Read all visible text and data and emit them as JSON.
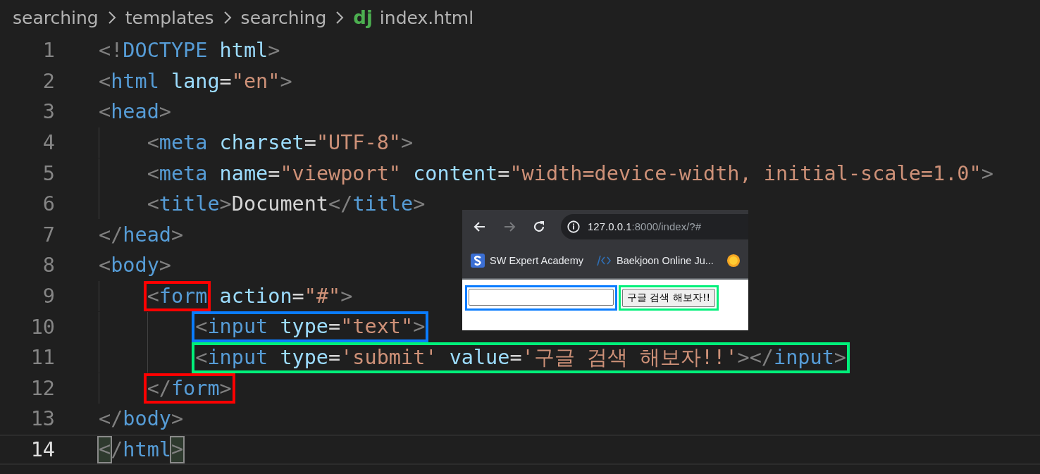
{
  "breadcrumb": [
    {
      "label": "searching"
    },
    {
      "label": "templates"
    },
    {
      "label": "searching"
    },
    {
      "label": "index.html",
      "logo_text": "dj"
    }
  ],
  "lines": [
    {
      "number": "1",
      "current": false,
      "segments": [
        {
          "kind": "code",
          "tokens": [
            {
              "kind": "punct",
              "text": "<!"
            },
            {
              "kind": "tag",
              "text": "DOCTYPE"
            },
            {
              "kind": "attr",
              "text": " html"
            },
            {
              "kind": "punct",
              "text": ">"
            }
          ]
        }
      ]
    },
    {
      "number": "2",
      "current": false,
      "segments": [
        {
          "kind": "code",
          "tokens": [
            {
              "kind": "punct",
              "text": "<"
            },
            {
              "kind": "tag",
              "text": "html"
            },
            {
              "kind": "attr",
              "text": " lang"
            },
            {
              "kind": "text",
              "text": "="
            },
            {
              "kind": "str",
              "text": "\"en\""
            },
            {
              "kind": "punct",
              "text": ">"
            }
          ]
        }
      ]
    },
    {
      "number": "3",
      "current": false,
      "segments": [
        {
          "kind": "code",
          "tokens": [
            {
              "kind": "punct",
              "text": "<"
            },
            {
              "kind": "tag",
              "text": "head"
            },
            {
              "kind": "punct",
              "text": ">"
            }
          ]
        }
      ],
      "children": [
        {
          "number": "4",
          "current": false,
          "segments": [
            {
              "kind": "code",
              "tokens": [
                {
                  "kind": "punct",
                  "text": "<"
                },
                {
                  "kind": "tag",
                  "text": "meta"
                },
                {
                  "kind": "attr",
                  "text": " charset"
                },
                {
                  "kind": "text",
                  "text": "="
                },
                {
                  "kind": "str",
                  "text": "\"UTF-8\""
                },
                {
                  "kind": "punct",
                  "text": ">"
                }
              ]
            }
          ]
        },
        {
          "number": "5",
          "current": false,
          "segments": [
            {
              "kind": "code",
              "tokens": [
                {
                  "kind": "punct",
                  "text": "<"
                },
                {
                  "kind": "tag",
                  "text": "meta"
                },
                {
                  "kind": "attr",
                  "text": " name"
                },
                {
                  "kind": "text",
                  "text": "="
                },
                {
                  "kind": "str",
                  "text": "\"viewport\""
                },
                {
                  "kind": "attr",
                  "text": " content"
                },
                {
                  "kind": "text",
                  "text": "="
                },
                {
                  "kind": "str",
                  "text": "\"width=device-width, initial-scale=1.0\""
                },
                {
                  "kind": "punct",
                  "text": ">"
                }
              ]
            }
          ]
        },
        {
          "number": "6",
          "current": false,
          "segments": [
            {
              "kind": "code",
              "tokens": [
                {
                  "kind": "punct",
                  "text": "<"
                },
                {
                  "kind": "tag",
                  "text": "title"
                },
                {
                  "kind": "punct",
                  "text": ">"
                },
                {
                  "kind": "text",
                  "text": "Document"
                },
                {
                  "kind": "punct",
                  "text": "</"
                },
                {
                  "kind": "tag",
                  "text": "title"
                },
                {
                  "kind": "punct",
                  "text": ">"
                }
              ]
            }
          ]
        }
      ]
    },
    {
      "number": "7",
      "current": false,
      "segments": [
        {
          "kind": "code",
          "tokens": [
            {
              "kind": "punct",
              "text": "</"
            },
            {
              "kind": "tag",
              "text": "head"
            },
            {
              "kind": "punct",
              "text": ">"
            }
          ]
        }
      ]
    },
    {
      "number": "8",
      "current": false,
      "segments": [
        {
          "kind": "code",
          "tokens": [
            {
              "kind": "punct",
              "text": "<"
            },
            {
              "kind": "tag",
              "text": "body"
            },
            {
              "kind": "punct",
              "text": ">"
            }
          ]
        }
      ],
      "children": [
        {
          "number": "9",
          "current": false,
          "segments": [
            {
              "kind": "box",
              "color": "#ff0000",
              "tokens": [
                {
                  "kind": "punct",
                  "text": "<"
                },
                {
                  "kind": "tag",
                  "text": "form"
                }
              ]
            },
            {
              "kind": "code",
              "tokens": [
                {
                  "kind": "attr",
                  "text": " action"
                },
                {
                  "kind": "text",
                  "text": "="
                },
                {
                  "kind": "str",
                  "text": "\"#\""
                },
                {
                  "kind": "punct",
                  "text": ">"
                }
              ]
            }
          ],
          "children": [
            {
              "number": "10",
              "current": false,
              "segments": [
                {
                  "kind": "box",
                  "color": "#0a7cff",
                  "tokens": [
                    {
                      "kind": "punct",
                      "text": "<"
                    },
                    {
                      "kind": "tag",
                      "text": "input"
                    },
                    {
                      "kind": "attr",
                      "text": " type"
                    },
                    {
                      "kind": "text",
                      "text": "="
                    },
                    {
                      "kind": "str",
                      "text": "\"text\""
                    },
                    {
                      "kind": "punct",
                      "text": ">"
                    }
                  ]
                }
              ]
            },
            {
              "number": "11",
              "current": false,
              "segments": [
                {
                  "kind": "box",
                  "color": "#00f07a",
                  "tokens": [
                    {
                      "kind": "punct",
                      "text": "<"
                    },
                    {
                      "kind": "tag",
                      "text": "input"
                    },
                    {
                      "kind": "attr",
                      "text": " type"
                    },
                    {
                      "kind": "text",
                      "text": "="
                    },
                    {
                      "kind": "str",
                      "text": "'submit'"
                    },
                    {
                      "kind": "attr",
                      "text": " value"
                    },
                    {
                      "kind": "text",
                      "text": "="
                    },
                    {
                      "kind": "str",
                      "text": "'구글 검색 해보자!!'"
                    },
                    {
                      "kind": "punct",
                      "text": "></"
                    },
                    {
                      "kind": "tag",
                      "text": "input"
                    },
                    {
                      "kind": "punct",
                      "text": ">"
                    }
                  ]
                }
              ]
            }
          ]
        },
        {
          "number": "12",
          "current": false,
          "segments": [
            {
              "kind": "box",
              "color": "#ff0000",
              "tokens": [
                {
                  "kind": "punct",
                  "text": "</"
                },
                {
                  "kind": "tag",
                  "text": "form"
                },
                {
                  "kind": "punct",
                  "text": ">"
                }
              ]
            }
          ]
        }
      ]
    },
    {
      "number": "13",
      "current": false,
      "segments": [
        {
          "kind": "code",
          "tokens": [
            {
              "kind": "punct",
              "text": "</"
            },
            {
              "kind": "tag",
              "text": "body"
            },
            {
              "kind": "punct",
              "text": ">"
            }
          ]
        }
      ]
    },
    {
      "number": "14",
      "current": true,
      "segments": [
        {
          "kind": "match",
          "tokens": [
            {
              "kind": "punct",
              "text": "<"
            }
          ]
        },
        {
          "kind": "code",
          "tokens": [
            {
              "kind": "punct",
              "text": "/"
            },
            {
              "kind": "tag",
              "text": "html"
            }
          ]
        },
        {
          "kind": "match",
          "tokens": [
            {
              "kind": "punct",
              "text": ">"
            }
          ]
        }
      ]
    }
  ],
  "browser": {
    "forward_disabled": true,
    "url_host": "127.0.0.1",
    "url_rest": ":8000/index/?#",
    "bookmarks": [
      {
        "kind": "s-logo",
        "label": "SW Expert Academy"
      },
      {
        "kind": "code",
        "label": "Baekjoon Online Ju..."
      },
      {
        "kind": "sun"
      }
    ],
    "page": {
      "field_box": {
        "color": "#0a7cff"
      },
      "submit_label": "구글 검색 해보자!!",
      "button_box": {
        "color": "#00f07a"
      }
    }
  }
}
